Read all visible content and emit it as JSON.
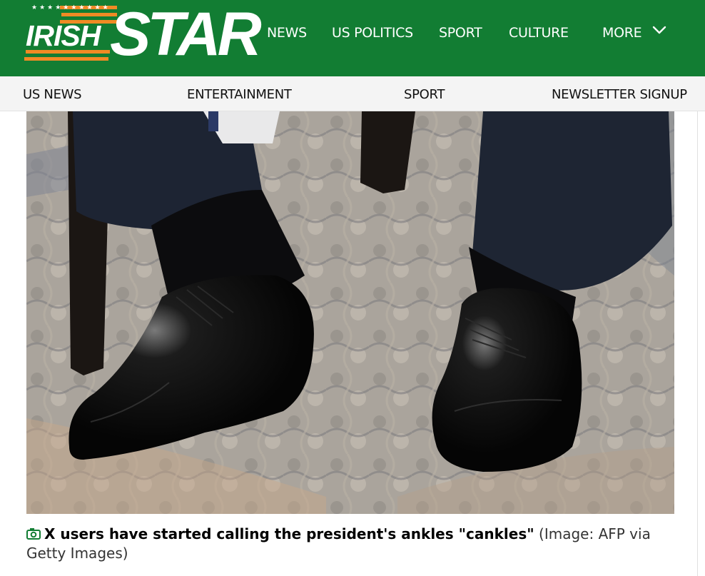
{
  "header": {
    "logo_word_1": "IRISH",
    "logo_word_2": "STAR",
    "logo_stars": "★★★★★★★★★★",
    "brand_color": "#127d33",
    "accent_color": "#f08a24",
    "nav": [
      {
        "label": "NEWS"
      },
      {
        "label": "US POLITICS"
      },
      {
        "label": "SPORT"
      },
      {
        "label": "CULTURE"
      },
      {
        "label": "MORE"
      }
    ],
    "more_icon": "chevron-down-icon"
  },
  "subnav": {
    "items": [
      {
        "label": "US NEWS"
      },
      {
        "label": "ENTERTAINMENT"
      },
      {
        "label": "SPORT"
      },
      {
        "label": "NEWSLETTER SIGNUP"
      }
    ]
  },
  "article": {
    "image_icon": "camera-icon",
    "caption": "X users have started calling the president's ankles \"cankles\"",
    "credit": "(Image: AFP via Getty Images)"
  }
}
